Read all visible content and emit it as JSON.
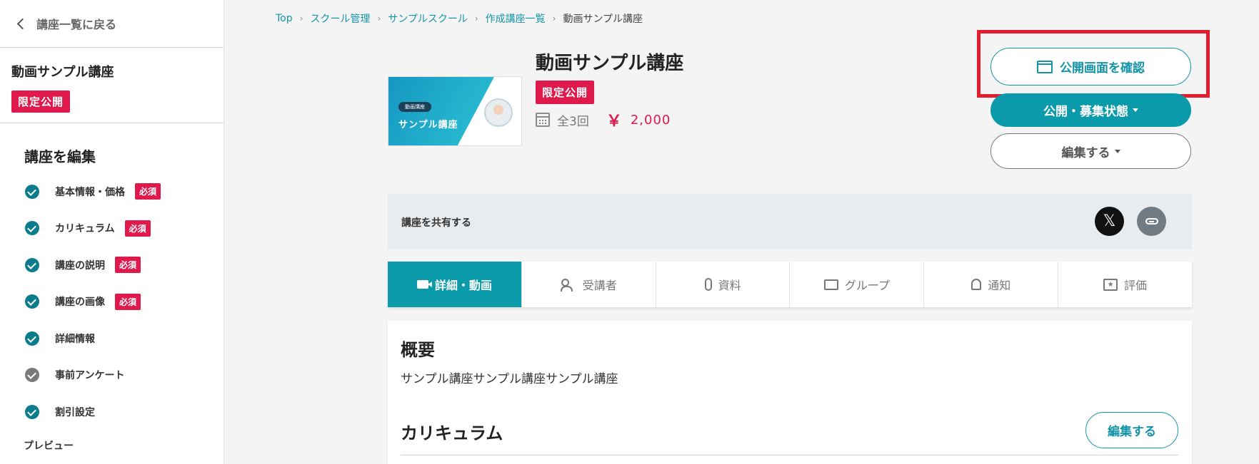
{
  "sidebar": {
    "back_label": "講座一覧に戻る",
    "course_name": "動画サンプル講座",
    "status_badge": "限定公開",
    "edit_heading": "講座を編集",
    "items": [
      {
        "label": "基本情報・価格",
        "required": "必須",
        "done": true
      },
      {
        "label": "カリキュラム",
        "required": "必須",
        "done": true
      },
      {
        "label": "講座の説明",
        "required": "必須",
        "done": true
      },
      {
        "label": "講座の画像",
        "required": "必須",
        "done": true
      },
      {
        "label": "詳細情報",
        "done": true
      },
      {
        "label": "事前アンケート",
        "done": false
      },
      {
        "label": "割引設定",
        "done": true
      }
    ],
    "preview_label": "プレビュー"
  },
  "breadcrumb": {
    "items": [
      "Top",
      "スクール管理",
      "サンプルスクール",
      "作成講座一覧"
    ],
    "current": "動画サンプル講座",
    "separator": "›"
  },
  "course": {
    "thumbnail": {
      "tag": "動画講座",
      "title": "サンプル講座"
    },
    "title": "動画サンプル講座",
    "badge": "限定公開",
    "session_count": "全3回",
    "currency_symbol": "￥",
    "price": "2,000"
  },
  "actions": {
    "view_public_label": "公開画面を確認",
    "publish_status_label": "公開・募集状態",
    "edit_label": "編集する"
  },
  "share": {
    "label": "講座を共有する",
    "x_glyph": "𝕏"
  },
  "tabs": [
    {
      "label": "詳細・動画",
      "icon": "video-camera-icon",
      "active": true
    },
    {
      "label": "受講者",
      "icon": "people-icon"
    },
    {
      "label": "資料",
      "icon": "paperclip-icon"
    },
    {
      "label": "グループ",
      "icon": "chat-icon"
    },
    {
      "label": "通知",
      "icon": "bell-icon"
    },
    {
      "label": "評価",
      "icon": "star-box-icon"
    }
  ],
  "content": {
    "overview_heading": "概要",
    "overview_text": "サンプル講座サンプル講座サンプル講座",
    "curriculum_heading": "カリキュラム",
    "curriculum_edit_label": "編集する"
  },
  "colors": {
    "accent": "#0b9aa9",
    "link": "#1494a8",
    "badge_red": "#e0194d",
    "highlight": "#e01e2e"
  }
}
